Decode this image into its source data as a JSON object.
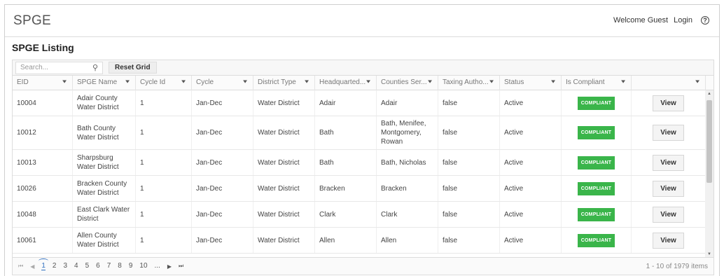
{
  "app": {
    "brand": "SPGE",
    "welcome": "Welcome Guest",
    "login": "Login",
    "help_glyph": "?"
  },
  "page": {
    "title": "SPGE Listing"
  },
  "toolbar": {
    "search_placeholder": "Search...",
    "search_icon": "search-icon",
    "reset_label": "Reset Grid"
  },
  "columns": [
    {
      "label": "EID"
    },
    {
      "label": "SPGE Name"
    },
    {
      "label": "Cycle Id"
    },
    {
      "label": "Cycle"
    },
    {
      "label": "District Type"
    },
    {
      "label": "Headquarted..."
    },
    {
      "label": "Counties Ser..."
    },
    {
      "label": "Taxing Autho..."
    },
    {
      "label": "Status"
    },
    {
      "label": "Is Compliant"
    },
    {
      "label": ""
    }
  ],
  "filter_glyph": "▼",
  "rows": [
    {
      "eid": "10004",
      "name": "Adair County Water District",
      "cycle_id": "1",
      "cycle": "Jan-Dec",
      "district_type": "Water District",
      "hq": "Adair",
      "counties": "Adair",
      "taxing": "false",
      "status": "Active",
      "compliant": "COMPLIANT",
      "action": "View"
    },
    {
      "eid": "10012",
      "name": "Bath County Water District",
      "cycle_id": "1",
      "cycle": "Jan-Dec",
      "district_type": "Water District",
      "hq": "Bath",
      "counties": "Bath, Menifee, Montgomery, Rowan",
      "taxing": "false",
      "status": "Active",
      "compliant": "COMPLIANT",
      "action": "View"
    },
    {
      "eid": "10013",
      "name": "Sharpsburg Water District",
      "cycle_id": "1",
      "cycle": "Jan-Dec",
      "district_type": "Water District",
      "hq": "Bath",
      "counties": "Bath, Nicholas",
      "taxing": "false",
      "status": "Active",
      "compliant": "COMPLIANT",
      "action": "View"
    },
    {
      "eid": "10026",
      "name": "Bracken County Water District",
      "cycle_id": "1",
      "cycle": "Jan-Dec",
      "district_type": "Water District",
      "hq": "Bracken",
      "counties": "Bracken",
      "taxing": "false",
      "status": "Active",
      "compliant": "COMPLIANT",
      "action": "View"
    },
    {
      "eid": "10048",
      "name": "East Clark Water District",
      "cycle_id": "1",
      "cycle": "Jan-Dec",
      "district_type": "Water District",
      "hq": "Clark",
      "counties": "Clark",
      "taxing": "false",
      "status": "Active",
      "compliant": "COMPLIANT",
      "action": "View"
    },
    {
      "eid": "10061",
      "name": "Allen County Water District",
      "cycle_id": "1",
      "cycle": "Jan-Dec",
      "district_type": "Water District",
      "hq": "Allen",
      "counties": "Allen",
      "taxing": "false",
      "status": "Active",
      "compliant": "COMPLIANT",
      "action": "View"
    }
  ],
  "pager": {
    "first": "⏮",
    "prev": "◀",
    "next": "▶",
    "last": "⏭",
    "pages": [
      "1",
      "2",
      "3",
      "4",
      "5",
      "6",
      "7",
      "8",
      "9",
      "10",
      "..."
    ],
    "current": "1",
    "summary": "1 - 10 of 1979 items"
  },
  "colors": {
    "compliant_badge": "#3ab54a",
    "active_page": "#2f6fbf"
  }
}
